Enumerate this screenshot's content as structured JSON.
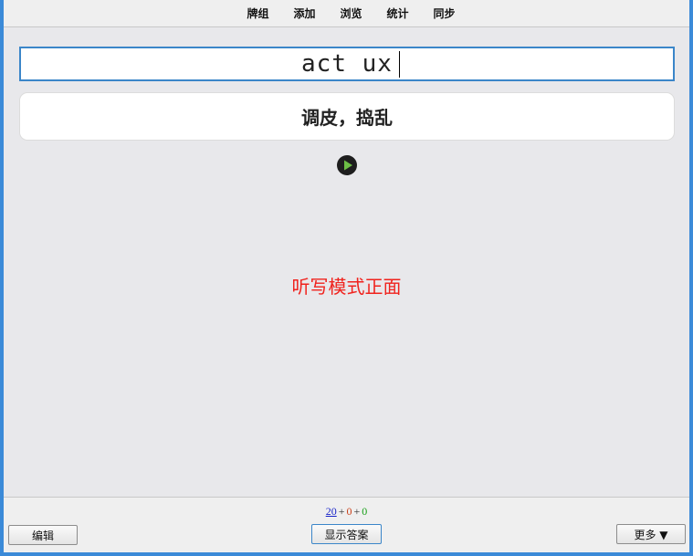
{
  "nav": {
    "items": [
      {
        "label": "牌组"
      },
      {
        "label": "添加"
      },
      {
        "label": "浏览"
      },
      {
        "label": "统计"
      },
      {
        "label": "同步"
      }
    ]
  },
  "review": {
    "typed_answer": "act ux",
    "card_text": "调皮，捣乱",
    "play_icon": "play-icon",
    "mode_label": "听写模式正面"
  },
  "bottom": {
    "counts": {
      "new": "20",
      "learning": "0",
      "review": "0",
      "separator": "+"
    },
    "edit_label": "编辑",
    "show_answer_label": "显示答案",
    "more_label": "更多 ▼"
  },
  "colors": {
    "accent": "#3b86c9",
    "mode_label": "#f0231e",
    "count_new": "#1a25c9",
    "count_learning": "#c9401a",
    "count_review": "#18a018",
    "play_fill": "#6cbe45"
  }
}
